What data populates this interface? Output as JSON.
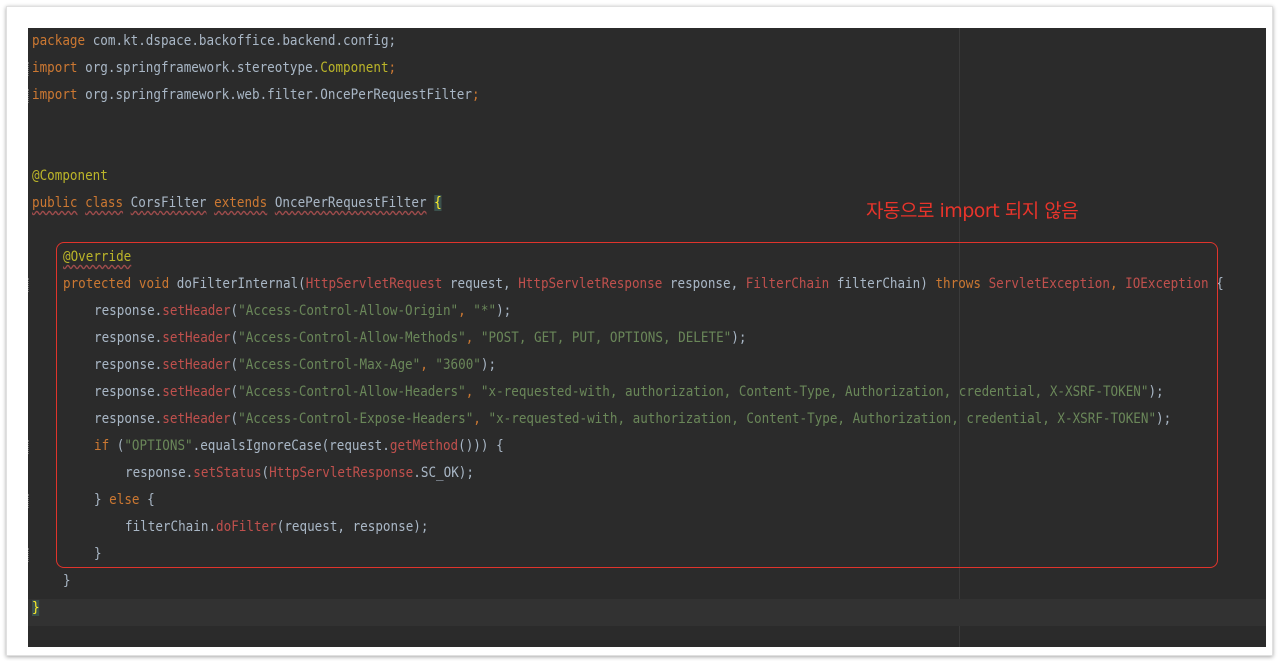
{
  "code": {
    "l1_kw": "package",
    "l1_rest": " com.kt.dspace.backoffice.backend.config;",
    "l2_kw": "import",
    "l2_pkg": " org.springframework.stereotype.",
    "l2_cls": "Component",
    "l2_end": ";",
    "l3_kw": "import",
    "l3_rest": " org.springframework.web.filter.OncePerRequestFilter",
    "l3_end": ";",
    "l4_ann": "@Component",
    "l5_public": "public",
    "l5_class": "class",
    "l5_name": "CorsFilter",
    "l5_extends": "extends",
    "l5_super": "OncePerRequestFilter",
    "l5_brace": "{",
    "l6_ann": "@Override",
    "l7_protected": "protected",
    "l7_void": "void",
    "l7_method": "doFilterInternal(",
    "l7_t1": "HttpServletRequest",
    "l7_p1": " request,",
    "l7_t2": "HttpServletResponse",
    "l7_p2": " response,",
    "l7_t3": "FilterChain",
    "l7_p3": " filterChain)",
    "l7_throws": "throws",
    "l7_e1": "ServletException",
    "l7_comma": ",",
    "l7_e2": "IOException",
    "l7_open": " {",
    "resp": "response.",
    "setHeader": "setHeader",
    "paren": "(",
    "comma": ", ",
    "close": ");",
    "h1_key": "\"Access-Control-Allow-Origin\"",
    "h1_val": "\"*\"",
    "h2_key": "\"Access-Control-Allow-Methods\"",
    "h2_val": "\"POST, GET, PUT, OPTIONS, DELETE\"",
    "h3_key": "\"Access-Control-Max-Age\"",
    "h3_val": "\"3600\"",
    "h4_key": "\"Access-Control-Allow-Headers\"",
    "h4_val": "\"x-requested-with, authorization, Content-Type, Authorization, credential, X-XSRF-TOKEN\"",
    "h5_key": "\"Access-Control-Expose-Headers\"",
    "h5_val": "\"x-requested-with, authorization, Content-Type, Authorization, credential, X-XSRF-TOKEN\"",
    "if_kw": "if",
    "if_open": " (",
    "if_str": "\"OPTIONS\"",
    "if_mid": ".equalsIgnoreCase(request.",
    "if_get": "getMethod",
    "if_end": "())) {",
    "set_status": "setStatus",
    "status_type": "HttpServletResponse",
    "status_rest": ".SC_OK);",
    "else_open": "} ",
    "else_kw": "else",
    "else_brace": " {",
    "fc_obj": "filterChain.",
    "fc_method": "doFilter",
    "fc_args": "(request, response);",
    "close_if": "}",
    "close_method": "}",
    "close_class": "}"
  },
  "annotation": {
    "note": "자동으로 import 되지 않음",
    "color": "#e8342b"
  },
  "colors": {
    "background": "#2b2b2b",
    "keyword": "#cc7832",
    "string": "#6a8759",
    "annotation": "#bbb529",
    "method_call": "#c0504d",
    "default_text": "#a9b7c6"
  }
}
